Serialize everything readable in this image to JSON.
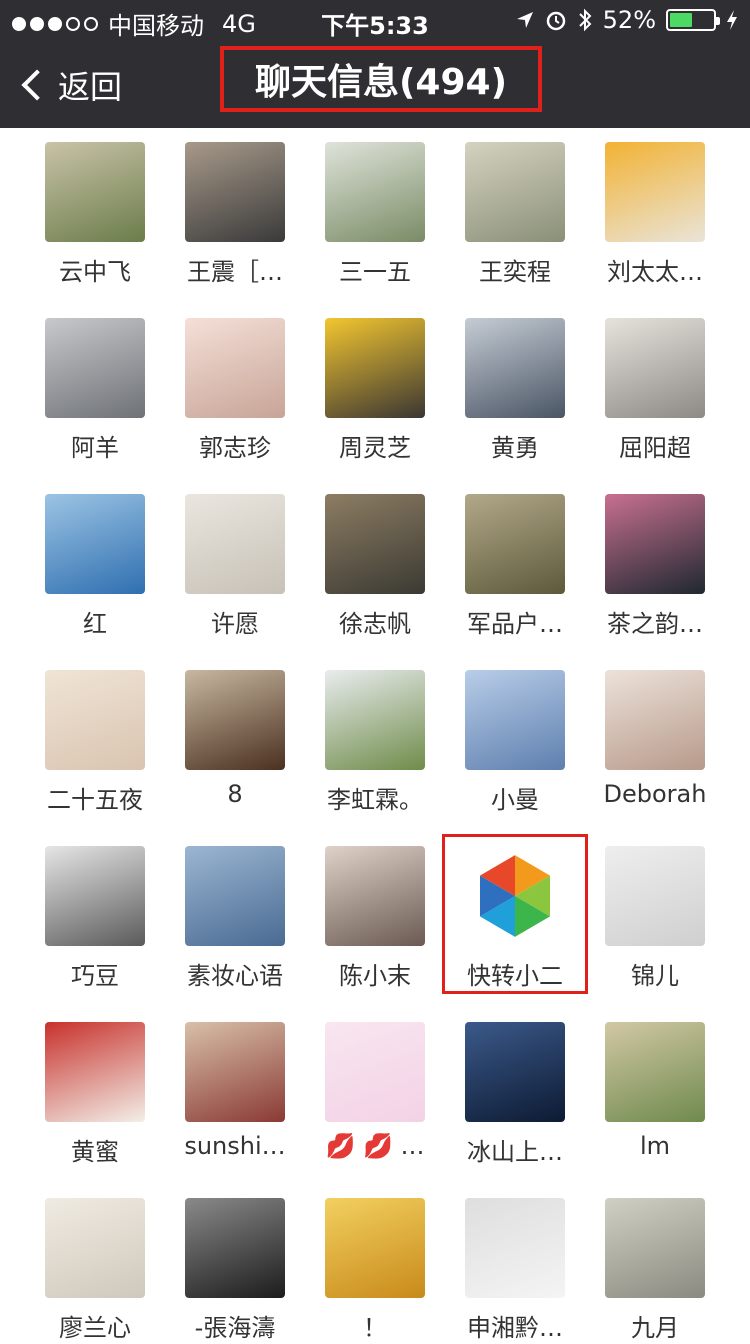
{
  "status_bar": {
    "signal_dots": [
      "on",
      "on",
      "on",
      "off",
      "off"
    ],
    "carrier": "中国移动",
    "network": "4G",
    "time": "下午5:33",
    "battery_percent": "52%",
    "battery_level": 0.52,
    "battery_color": "#4cd964",
    "icons": [
      "location-arrow-icon",
      "alarm-icon",
      "bluetooth-icon",
      "charging-bolt-icon"
    ]
  },
  "nav": {
    "back_label": "返回",
    "title": "聊天信息(494)",
    "highlight_color": "#e0201a",
    "bar_color": "#2e2e33"
  },
  "members": [
    {
      "name": "云中飞",
      "avatar": "mountain-path-photo"
    },
    {
      "name": "王震［…",
      "avatar": "man-in-suit-photo"
    },
    {
      "name": "三一五",
      "avatar": "mountain-bench-photo"
    },
    {
      "name": "王奕程",
      "avatar": "river-bank-photo"
    },
    {
      "name": "刘太太…",
      "avatar": "painted-hands-photo"
    },
    {
      "name": "阿羊",
      "avatar": "misty-tree-photo"
    },
    {
      "name": "郭志珍",
      "avatar": "girl-selfie-photo"
    },
    {
      "name": "周灵芝",
      "avatar": "smiley-face-photo"
    },
    {
      "name": "黄勇",
      "avatar": "man-window-photo"
    },
    {
      "name": "屈阳超",
      "avatar": "young-man-room-photo"
    },
    {
      "name": "红",
      "avatar": "blue-sky-rocks-photo"
    },
    {
      "name": "许愿",
      "avatar": "calm-lake-photo"
    },
    {
      "name": "徐志帆",
      "avatar": "old-house-photo"
    },
    {
      "name": "军品户…",
      "avatar": "soldier-photo"
    },
    {
      "name": "茶之韵…",
      "avatar": "sunset-boat-photo"
    },
    {
      "name": "二十五夜",
      "avatar": "cat-sunglasses-photo"
    },
    {
      "name": "8",
      "avatar": "car-headlight-photo"
    },
    {
      "name": "李虹霖。",
      "avatar": "bride-flowers-photo"
    },
    {
      "name": "小曼",
      "avatar": "sky-branches-photo"
    },
    {
      "name": "Deborah",
      "avatar": "child-wink-photo"
    },
    {
      "name": "巧豆",
      "avatar": "child-glasses-photo"
    },
    {
      "name": "素妆心语",
      "avatar": "umbrella-silhouette-photo"
    },
    {
      "name": "陈小末",
      "avatar": "woman-hat-photo"
    },
    {
      "name": "快转小二",
      "avatar": "colorful-hexagon-logo"
    },
    {
      "name": "锦儿",
      "avatar": "toddler-flowers-photo"
    },
    {
      "name": "黄蜜",
      "avatar": "cartoon-santa-avatar"
    },
    {
      "name": "sunshi…",
      "avatar": "woman-sunglasses-photo"
    },
    {
      "name": "💋 💋 …",
      "avatar": "cartoon-girl-avatar"
    },
    {
      "name": "冰山上…",
      "avatar": "moon-mountain-photo"
    },
    {
      "name": "lm",
      "avatar": "hay-bales-photo"
    },
    {
      "name": "廖兰心",
      "avatar": "woman-portrait-photo"
    },
    {
      "name": "-張海濤",
      "avatar": "bw-man-photo"
    },
    {
      "name": "！",
      "avatar": "golden-woman-poster"
    },
    {
      "name": "申湘黔…",
      "avatar": "woman-black-dress-photo"
    },
    {
      "name": "九月",
      "avatar": "jade-pendant-photo"
    }
  ]
}
